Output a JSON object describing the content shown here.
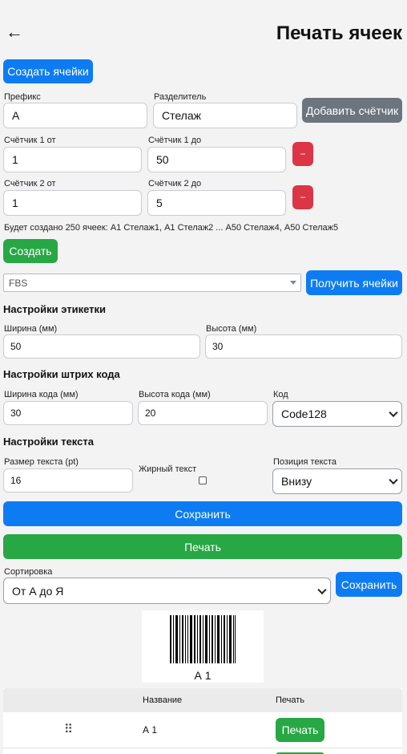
{
  "header": {
    "back_glyph": "←",
    "title": "Печать ячеек"
  },
  "create_cells_button": "Создать ячейки",
  "form": {
    "prefix_label": "Префикс",
    "prefix_value": "А",
    "separator_label": "Разделитель",
    "separator_value": "Стелаж",
    "add_counter_button": "Добавить счётчик",
    "counter1_from_label": "Счётчик 1 от",
    "counter1_from_value": "1",
    "counter1_to_label": "Счётчик 1 до",
    "counter1_to_value": "50",
    "counter2_from_label": "Счётчик 2 от",
    "counter2_from_value": "1",
    "counter2_to_label": "Счётчик 2 до",
    "counter2_to_value": "5",
    "remove_glyph": "−",
    "summary": "Будет создано 250 ячеек: А1 Стелаж1, А1 Стелаж2 ... А50 Стелаж4, А50 Стелаж5",
    "create_button": "Создать"
  },
  "warehouse": {
    "selected": "FBS",
    "get_cells_button": "Получить ячейки"
  },
  "label_settings": {
    "title": "Настройки этикетки",
    "width_label": "Ширина (мм)",
    "width_value": "50",
    "height_label": "Высота (мм)",
    "height_value": "30"
  },
  "barcode_settings": {
    "title": "Настройки штрих кода",
    "code_width_label": "Ширина кода (мм)",
    "code_width_value": "30",
    "code_height_label": "Высота кода (мм)",
    "code_height_value": "20",
    "code_label": "Код",
    "code_value": "Code128"
  },
  "text_settings": {
    "title": "Настройки текста",
    "size_label": "Размер текста (pt)",
    "size_value": "16",
    "bold_label": "Жирный текст",
    "position_label": "Позиция текста",
    "position_value": "Внизу"
  },
  "save_button": "Сохранить",
  "print_button": "Печать",
  "sort": {
    "label": "Сортировка",
    "value": "От А до Я",
    "save_button": "Сохранить"
  },
  "preview": {
    "text": "А 1"
  },
  "table": {
    "headers": [
      "",
      "Название",
      "Печать"
    ],
    "rows": [
      {
        "drag_glyph": "⠿",
        "name": "А 1",
        "print_label": "Печать"
      }
    ]
  },
  "colors": {
    "primary": "#0d7cf2",
    "success": "#28a745",
    "secondary": "#6c757d",
    "danger": "#dc3545"
  }
}
